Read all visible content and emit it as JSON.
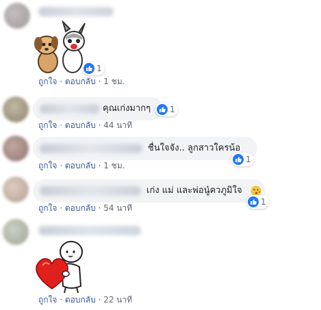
{
  "ui": {
    "like_color": "#2078f4",
    "action_link_color": "#385898",
    "meta_color": "#606770",
    "bubble_color": "#f2f3f5"
  },
  "comments": [
    {
      "type": "sticker",
      "sticker_icon": "dog-and-bunny-sticker",
      "reaction_count": "1",
      "like_label": "ถูกใจ",
      "reply_label": "ตอบกลับ",
      "time": "1 ชม."
    },
    {
      "type": "text",
      "text": "คุณเก่งมากๆ",
      "reaction_count": "1",
      "like_label": "ถูกใจ",
      "reply_label": "ตอบกลับ",
      "time": "44 นาที"
    },
    {
      "type": "text",
      "text": "ชื่นใจจัง.. ลูกสาวใครน้อ",
      "reaction_count": "1",
      "like_label": "ถูกใจ",
      "reply_label": "ตอบกลับ",
      "time": "1 ชม."
    },
    {
      "type": "text",
      "text": "เก่ง แม่ และพ่อนู๋ควภูมิใจ",
      "emoji_icon": "kissing-face-emoji",
      "reaction_count": "1",
      "like_label": "ถูกใจ",
      "reply_label": "ตอบกลับ",
      "time": "54 นาที"
    },
    {
      "type": "sticker",
      "sticker_icon": "heart-hug-sticker",
      "like_label": "ถูกใจ",
      "reply_label": "ตอบกลับ",
      "time": "22 นาที"
    }
  ]
}
